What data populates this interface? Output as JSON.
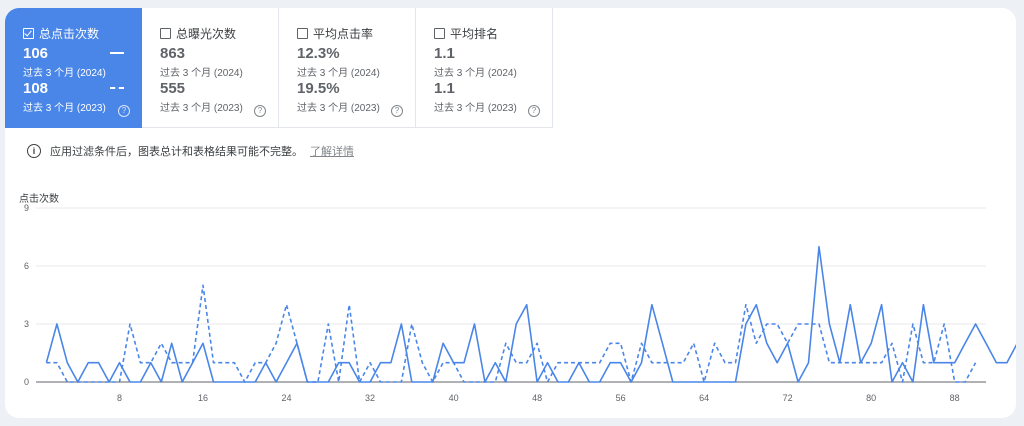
{
  "metrics": [
    {
      "label": "总点击次数",
      "checked": true,
      "value_current": "106",
      "period_current": "过去 3 个月 (2024)",
      "value_previous": "108",
      "period_previous": "过去 3 个月 (2023)"
    },
    {
      "label": "总曝光次数",
      "checked": false,
      "value_current": "863",
      "period_current": "过去 3 个月 (2024)",
      "value_previous": "555",
      "period_previous": "过去 3 个月 (2023)"
    },
    {
      "label": "平均点击率",
      "checked": false,
      "value_current": "12.3%",
      "period_current": "过去 3 个月 (2024)",
      "value_previous": "19.5%",
      "period_previous": "过去 3 个月 (2023)"
    },
    {
      "label": "平均排名",
      "checked": false,
      "value_current": "1.1",
      "period_current": "过去 3 个月 (2024)",
      "value_previous": "1.1",
      "period_previous": "过去 3 个月 (2023)"
    }
  ],
  "help_glyph": "?",
  "info_glyph": "i",
  "notice": {
    "text": "应用过滤条件后，图表总计和表格结果可能不完整。",
    "link": "了解详情"
  },
  "colors": {
    "accent": "#4a86e8",
    "line": "#4a86e8"
  },
  "chart_data": {
    "type": "line",
    "ylabel": "点击次数",
    "ylim": [
      0,
      9
    ],
    "y_ticks": [
      0,
      3,
      6,
      9
    ],
    "x_ticks": [
      8,
      16,
      24,
      32,
      40,
      48,
      56,
      64,
      72,
      80,
      88
    ],
    "xlim": [
      0,
      91
    ],
    "series": [
      {
        "style": "solid",
        "values": [
          1,
          3,
          1,
          0,
          1,
          1,
          0,
          1,
          0,
          0,
          1,
          0,
          2,
          0,
          1,
          2,
          0,
          0,
          0,
          0,
          0,
          1,
          0,
          1,
          2,
          0,
          0,
          0,
          1,
          1,
          0,
          0,
          1,
          1,
          3,
          0,
          0,
          0,
          2,
          1,
          1,
          3,
          0,
          1,
          0,
          3,
          4,
          0,
          1,
          0,
          0,
          1,
          0,
          0,
          1,
          1,
          0,
          1,
          4,
          2,
          0,
          0,
          0,
          0,
          0,
          0,
          0,
          3,
          4,
          2,
          1,
          2,
          0,
          1,
          7,
          3,
          1,
          4,
          1,
          2,
          4,
          0,
          1,
          0,
          4,
          1,
          1,
          1,
          2,
          3,
          2,
          1,
          1,
          2,
          1
        ]
      },
      {
        "style": "dashed",
        "values": [
          1,
          1,
          0,
          0,
          0,
          0,
          0,
          0,
          3,
          1,
          1,
          2,
          1,
          1,
          1,
          5,
          1,
          1,
          1,
          0,
          1,
          1,
          2,
          4,
          2,
          0,
          0,
          3,
          0,
          4,
          0,
          1,
          0,
          0,
          0,
          3,
          1,
          0,
          1,
          1,
          0,
          0,
          0,
          0,
          2,
          1,
          1,
          2,
          0,
          1,
          1,
          1,
          1,
          1,
          2,
          2,
          0,
          2,
          1,
          1,
          1,
          1,
          2,
          0,
          2,
          1,
          1,
          4,
          2,
          3,
          3,
          2,
          3,
          3,
          3,
          1,
          1,
          1,
          1,
          1,
          1,
          2,
          0,
          3,
          1,
          1,
          3,
          0,
          0,
          1
        ]
      }
    ]
  }
}
